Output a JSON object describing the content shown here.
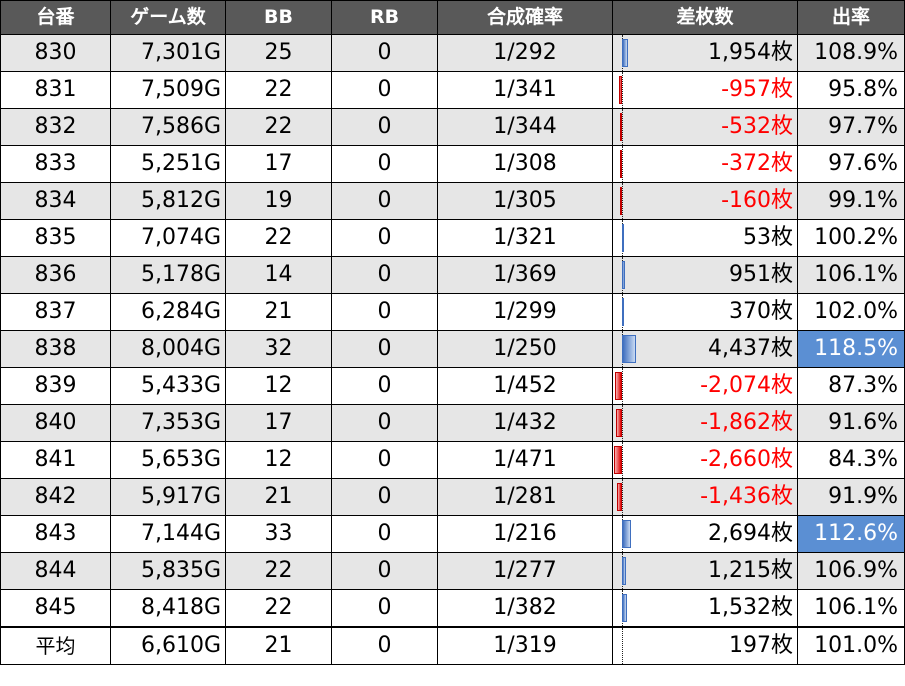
{
  "headers": {
    "no": "台番",
    "games": "ゲーム数",
    "bb": "BB",
    "rb": "RB",
    "rate": "合成確率",
    "diff": "差枚数",
    "pct": "出率"
  },
  "rows": [
    {
      "no": "830",
      "games": "7,301G",
      "bb": "25",
      "rb": "0",
      "rate": "1/292",
      "diff": "1,954枚",
      "diff_value": 1954,
      "pct": "108.9%"
    },
    {
      "no": "831",
      "games": "7,509G",
      "bb": "22",
      "rb": "0",
      "rate": "1/341",
      "diff": "-957枚",
      "diff_value": -957,
      "pct": "95.8%"
    },
    {
      "no": "832",
      "games": "7,586G",
      "bb": "22",
      "rb": "0",
      "rate": "1/344",
      "diff": "-532枚",
      "diff_value": -532,
      "pct": "97.7%"
    },
    {
      "no": "833",
      "games": "5,251G",
      "bb": "17",
      "rb": "0",
      "rate": "1/308",
      "diff": "-372枚",
      "diff_value": -372,
      "pct": "97.6%"
    },
    {
      "no": "834",
      "games": "5,812G",
      "bb": "19",
      "rb": "0",
      "rate": "1/305",
      "diff": "-160枚",
      "diff_value": -160,
      "pct": "99.1%"
    },
    {
      "no": "835",
      "games": "7,074G",
      "bb": "22",
      "rb": "0",
      "rate": "1/321",
      "diff": "53枚",
      "diff_value": 53,
      "pct": "100.2%"
    },
    {
      "no": "836",
      "games": "5,178G",
      "bb": "14",
      "rb": "0",
      "rate": "1/369",
      "diff": "951枚",
      "diff_value": 951,
      "pct": "106.1%"
    },
    {
      "no": "837",
      "games": "6,284G",
      "bb": "21",
      "rb": "0",
      "rate": "1/299",
      "diff": "370枚",
      "diff_value": 370,
      "pct": "102.0%"
    },
    {
      "no": "838",
      "games": "8,004G",
      "bb": "32",
      "rb": "0",
      "rate": "1/250",
      "diff": "4,437枚",
      "diff_value": 4437,
      "pct": "118.5%",
      "highlight": true
    },
    {
      "no": "839",
      "games": "5,433G",
      "bb": "12",
      "rb": "0",
      "rate": "1/452",
      "diff": "-2,074枚",
      "diff_value": -2074,
      "pct": "87.3%"
    },
    {
      "no": "840",
      "games": "7,353G",
      "bb": "17",
      "rb": "0",
      "rate": "1/432",
      "diff": "-1,862枚",
      "diff_value": -1862,
      "pct": "91.6%"
    },
    {
      "no": "841",
      "games": "5,653G",
      "bb": "12",
      "rb": "0",
      "rate": "1/471",
      "diff": "-2,660枚",
      "diff_value": -2660,
      "pct": "84.3%"
    },
    {
      "no": "842",
      "games": "5,917G",
      "bb": "21",
      "rb": "0",
      "rate": "1/281",
      "diff": "-1,436枚",
      "diff_value": -1436,
      "pct": "91.9%"
    },
    {
      "no": "843",
      "games": "7,144G",
      "bb": "33",
      "rb": "0",
      "rate": "1/216",
      "diff": "2,694枚",
      "diff_value": 2694,
      "pct": "112.6%",
      "highlight": true
    },
    {
      "no": "844",
      "games": "5,835G",
      "bb": "22",
      "rb": "0",
      "rate": "1/277",
      "diff": "1,215枚",
      "diff_value": 1215,
      "pct": "106.9%"
    },
    {
      "no": "845",
      "games": "8,418G",
      "bb": "22",
      "rb": "0",
      "rate": "1/382",
      "diff": "1,532枚",
      "diff_value": 1532,
      "pct": "106.1%"
    }
  ],
  "average": {
    "label": "平均",
    "games": "6,610G",
    "bb": "21",
    "rb": "0",
    "rate": "1/319",
    "diff": "197枚",
    "diff_value": 197,
    "pct": "101.0%"
  },
  "colors": {
    "header_bg": "#595959",
    "row_stripe": "#e6e6e6",
    "negative_text": "#ff0000",
    "highlight_bg": "#5b8fd3",
    "bar_positive": "#3f6fbf",
    "bar_negative": "#e00000"
  }
}
